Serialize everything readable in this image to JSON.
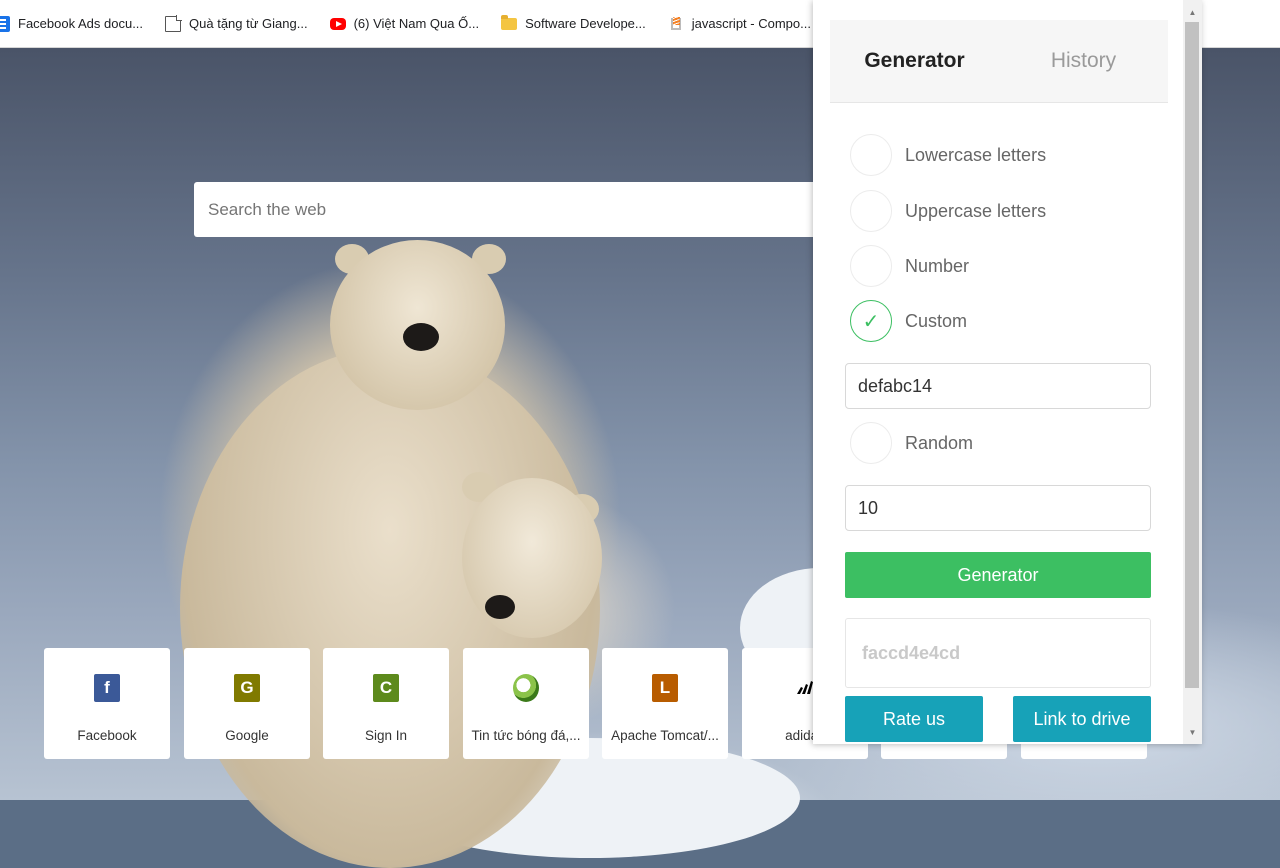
{
  "bookmarks": [
    {
      "label": "Facebook Ads docu...",
      "icon": "docs-icon"
    },
    {
      "label": "Quà tặng từ Giang...",
      "icon": "page-icon"
    },
    {
      "label": "(6) Việt Nam Qua Ố...",
      "icon": "youtube-icon"
    },
    {
      "label": "Software Develope...",
      "icon": "folder-icon"
    },
    {
      "label": "javascript - Compo...",
      "icon": "stackoverflow-icon"
    }
  ],
  "search": {
    "placeholder": "Search the web"
  },
  "tiles": [
    {
      "label": "Facebook",
      "letter": "f",
      "color": "#3b5998"
    },
    {
      "label": "Google",
      "letter": "G",
      "color": "#807a00"
    },
    {
      "label": "Sign In",
      "letter": "C",
      "color": "#5d8a1c"
    },
    {
      "label": "Tin tức bóng đá,...",
      "letter": "",
      "color": "#8bc34a"
    },
    {
      "label": "Apache Tomcat/...",
      "letter": "L",
      "color": "#b85c00"
    },
    {
      "label": "adidas",
      "letter": "",
      "color": "#000000"
    }
  ],
  "popup": {
    "tabs": {
      "generator": "Generator",
      "history": "History"
    },
    "options": {
      "lowercase": "Lowercase letters",
      "uppercase": "Uppercase letters",
      "number": "Number",
      "custom": "Custom",
      "random": "Random"
    },
    "checked_option": "custom",
    "check_mark": "✓",
    "custom_value": "defabc14",
    "length_value": "10",
    "generate_label": "Generator",
    "result": "faccd4e4cd",
    "rate_label": "Rate us",
    "drive_label": "Link to drive",
    "accent_color": "#3cbf62",
    "button_color": "#17a2b8"
  }
}
